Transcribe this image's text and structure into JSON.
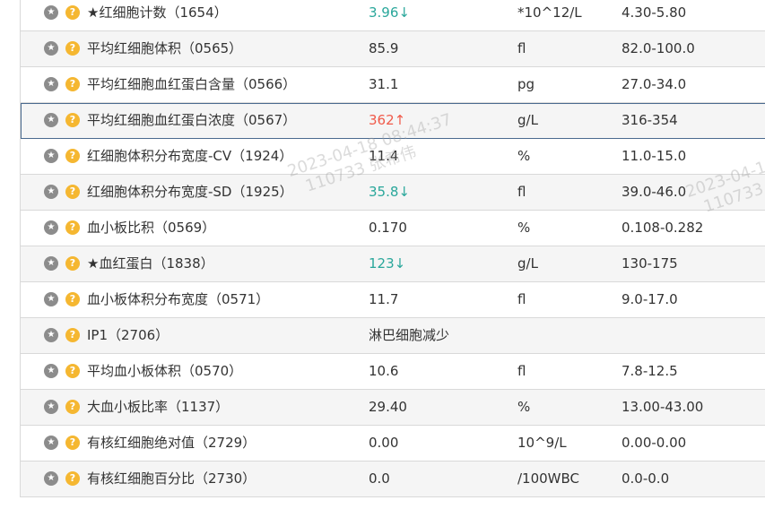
{
  "rows": [
    {
      "name": "★红细胞计数（1654）",
      "result": "3.96↓",
      "flag": "down",
      "unit": "*10^12/L",
      "range": "4.30-5.80"
    },
    {
      "name": "平均红细胞体积（0565）",
      "result": "85.9",
      "flag": "",
      "unit": "fl",
      "range": "82.0-100.0"
    },
    {
      "name": "平均红细胞血红蛋白含量（0566）",
      "result": "31.1",
      "flag": "",
      "unit": "pg",
      "range": "27.0-34.0"
    },
    {
      "name": "平均红细胞血红蛋白浓度（0567）",
      "result": "362↑",
      "flag": "up",
      "unit": "g/L",
      "range": "316-354"
    },
    {
      "name": "红细胞体积分布宽度-CV（1924）",
      "result": "11.4",
      "flag": "",
      "unit": "%",
      "range": "11.0-15.0"
    },
    {
      "name": "红细胞体积分布宽度-SD（1925）",
      "result": "35.8↓",
      "flag": "down",
      "unit": "fl",
      "range": "39.0-46.0"
    },
    {
      "name": "血小板比积（0569）",
      "result": "0.170",
      "flag": "",
      "unit": "%",
      "range": "0.108-0.282"
    },
    {
      "name": "★血红蛋白（1838）",
      "result": "123↓",
      "flag": "down",
      "unit": "g/L",
      "range": "130-175"
    },
    {
      "name": "血小板体积分布宽度（0571）",
      "result": "11.7",
      "flag": "",
      "unit": "fl",
      "range": "9.0-17.0"
    },
    {
      "name": "IP1（2706）",
      "result": "淋巴细胞减少",
      "flag": "",
      "unit": "",
      "range": ""
    },
    {
      "name": "平均血小板体积（0570）",
      "result": "10.6",
      "flag": "",
      "unit": "fl",
      "range": "7.8-12.5"
    },
    {
      "name": "大血小板比率（1137）",
      "result": "29.40",
      "flag": "",
      "unit": "%",
      "range": "13.00-43.00"
    },
    {
      "name": "有核红细胞绝对值（2729）",
      "result": "0.00",
      "flag": "",
      "unit": "10^9/L",
      "range": "0.00-0.00"
    },
    {
      "name": "有核红细胞百分比（2730）",
      "result": "0.0",
      "flag": "",
      "unit": "/100WBC",
      "range": "0.0-0.0"
    }
  ],
  "selected_row": 3,
  "icons": {
    "star": "star-icon",
    "help": "question-icon",
    "star_glyph": "★",
    "help_glyph": "?"
  },
  "watermark": {
    "line1": "2023-04-18 08:44:37",
    "line2": "110733 张希伟"
  },
  "colors": {
    "down": "#2aa79b",
    "up": "#f05a4a",
    "star_icon": "#8c8c8c",
    "help_icon": "#f5b731",
    "selected_border": "#4a6a8f"
  }
}
